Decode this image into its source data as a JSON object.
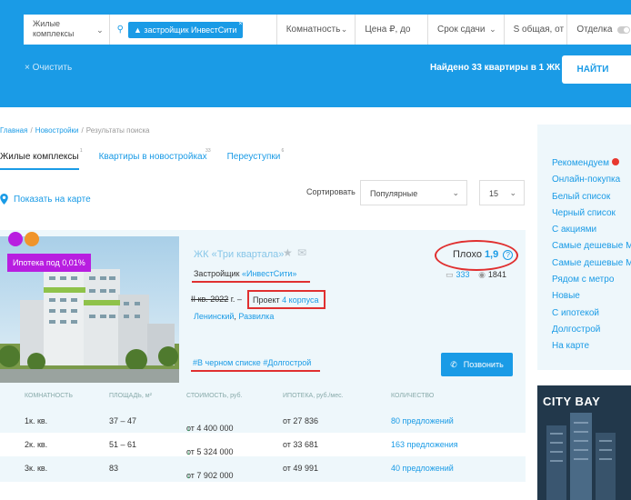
{
  "search": {
    "type_select": "Жилые комплексы",
    "tag": "застройщик ИнвестСити",
    "rooms": "Комнатность",
    "price": "Цена ₽, до",
    "deadline": "Срок сдачи",
    "area": "S общая, от",
    "finish": "Отделка",
    "clear_label": "Очистить",
    "found_text": "Найдено 33 квартиры в 1 ЖК",
    "find_button": "НАЙТИ"
  },
  "breadcrumbs": [
    "Главная",
    "Новостройки",
    "Результаты поиска"
  ],
  "tabs": [
    {
      "label": "Жилые комплексы",
      "count": "1",
      "active": true
    },
    {
      "label": "Квартиры в новостройках",
      "count": "33",
      "active": false
    },
    {
      "label": "Переуступки",
      "count": "6",
      "active": false
    }
  ],
  "map_link": "Показать на карте",
  "sort": {
    "label": "Сортировать",
    "value": "Популярные",
    "per_page": "15"
  },
  "card": {
    "mortgage_badge": "Ипотека под 0,01%",
    "name": "ЖК «Три квартала»",
    "developer_prefix": "Застройщик ",
    "developer_name": "«ИнвестСити»",
    "deadline_old": "II кв. 2022",
    "deadline_suffix": " г. – ",
    "project_label": "Проект ",
    "project_link": "4 корпуса",
    "district": "Ленинский",
    "district_sep": ", ",
    "settlement": "Развилка",
    "hashtags": "#В черном списке  #Долгострой",
    "rating_label": "Плохо",
    "rating_value": "1,9",
    "reviews": "333",
    "views": "1841",
    "call_button": "Позвонить"
  },
  "table": {
    "headers": [
      "КОМНАТНОСТЬ",
      "ПЛОЩАДЬ, м²",
      "СТОИМОСТЬ, руб.",
      "ИПОТЕКА, руб./мес.",
      "КОЛИЧЕСТВО"
    ],
    "rows": [
      {
        "rooms": "1к. кв.",
        "area": "37 – 47",
        "price": "от 4 400 000",
        "mortgage": "от 27 836",
        "offers": "80 предложений"
      },
      {
        "rooms": "2к. кв.",
        "area": "51 – 61",
        "price": "от 5 324 000",
        "mortgage": "от 33 681",
        "offers": "163 предложения"
      },
      {
        "rooms": "3к. кв.",
        "area": "83",
        "price": "от 7 902 000",
        "mortgage": "от 49 991",
        "offers": "40 предложений"
      }
    ]
  },
  "sidebar": {
    "items": [
      "Рекомендуем",
      "Онлайн-покупка",
      "Белый список",
      "Черный список",
      "С акциями",
      "Самые дешевые М",
      "Самые дешевые М",
      "Рядом с метро",
      "Новые",
      "С ипотекой",
      "Долгострой",
      "На карте"
    ]
  },
  "ad": {
    "brand": "CITY BAY"
  },
  "colors": {
    "primary": "#1a9be6",
    "highlight_red": "#e03030",
    "badge_purple": "#b81ee0"
  }
}
